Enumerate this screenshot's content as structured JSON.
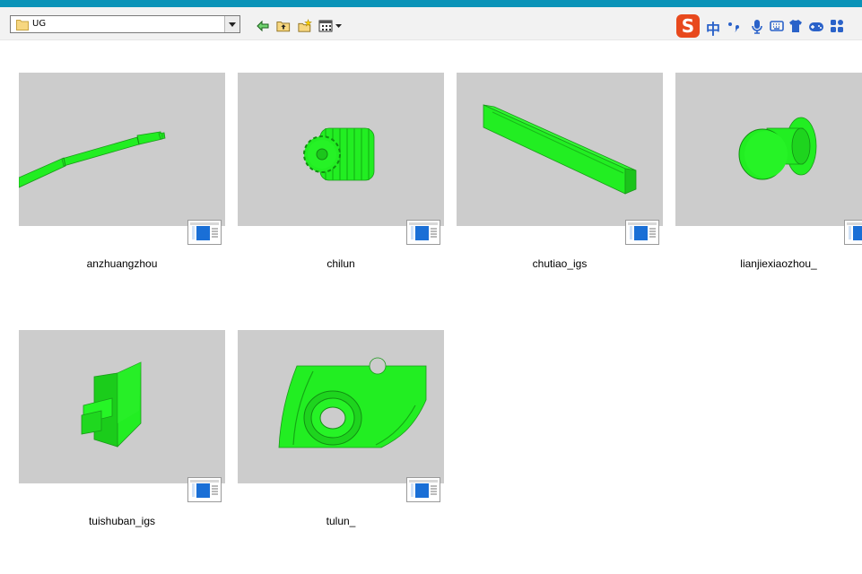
{
  "toolbar": {
    "location_label": "UG",
    "back_icon": "back-arrow-icon",
    "up_icon": "folder-up-icon",
    "new_folder_icon": "new-folder-icon",
    "view_menu_icon": "view-menu-icon"
  },
  "ime_bar": {
    "logo_text": "S",
    "mode_text": "中",
    "colors": {
      "logo_bg": "#e8491d",
      "icon_blue": "#2a62c9"
    }
  },
  "files": [
    {
      "name": "anzhuangzhou"
    },
    {
      "name": "chilun"
    },
    {
      "name": "chutiao_igs"
    },
    {
      "name": "lianjiexiaozhou_"
    },
    {
      "name": "tuishuban_igs"
    },
    {
      "name": "tulun_"
    }
  ],
  "colors": {
    "title_strip": "#0a93b8",
    "thumbnail_bg": "#cccccc",
    "model_green": "#22ee22"
  }
}
